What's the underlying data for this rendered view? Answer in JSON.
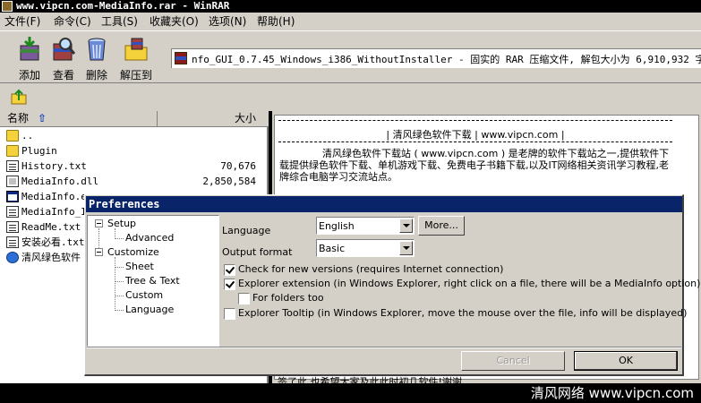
{
  "window": {
    "title": "www.vipcn.com-MediaInfo.rar - WinRAR"
  },
  "menu": [
    "文件(F)",
    "命令(C)",
    "工具(S)",
    "收藏夹(O)",
    "选项(N)",
    "帮助(H)"
  ],
  "toolbar": {
    "add": "添加",
    "view": "查看",
    "delete": "删除",
    "extract": "解压到"
  },
  "path": "nfo_GUI_0.7.45_Windows_i386_WithoutInstaller - 固实的 RAR 压缩文件, 解包大小为 6,910,932 字节",
  "filelist": {
    "col_name": "名称",
    "col_size": "大小",
    "rows": [
      {
        "name": "..",
        "size": "",
        "icon": "folder-icon"
      },
      {
        "name": "Plugin",
        "size": "",
        "icon": "folder-icon"
      },
      {
        "name": "History.txt",
        "size": "70,676",
        "icon": "text-file-icon"
      },
      {
        "name": "MediaInfo.dll",
        "size": "2,850,584",
        "icon": "dll-file-icon"
      },
      {
        "name": "MediaInfo.ex",
        "size": "",
        "icon": "exe-file-icon"
      },
      {
        "name": "MediaInfo_In",
        "size": "",
        "icon": "text-file-icon"
      },
      {
        "name": "ReadMe.txt",
        "size": "",
        "icon": "text-file-icon"
      },
      {
        "name": "安装必看.txt",
        "size": "",
        "icon": "text-file-icon"
      },
      {
        "name": "清风绿色软件",
        "size": "",
        "icon": "web-shortcut-icon"
      }
    ]
  },
  "comment": {
    "site": "|  清风绿色软件下载  |  www.vipcn.com  |",
    "para": "清风绿色软件下载站 ( www.vipcn.com ) 是老牌的软件下载站之一,提供软件下载提供绿色软件下载、单机游戏下载、免费电子书籍下载,以及IT网络相关资讯学习教程,老牌综合电脑学习交流站点。",
    "bottom": "签了此,也希望大家及此此时初几软件!谢谢"
  },
  "watermark": "清风网络 www.vipcn.com",
  "prefs": {
    "title": "Preferences",
    "tree": [
      {
        "label": "Setup",
        "level": 0
      },
      {
        "label": "Advanced",
        "level": 1
      },
      {
        "label": "Customize",
        "level": 0
      },
      {
        "label": "Sheet",
        "level": 1
      },
      {
        "label": "Tree & Text",
        "level": 1
      },
      {
        "label": "Custom",
        "level": 1
      },
      {
        "label": "Language",
        "level": 1
      }
    ],
    "language_label": "Language",
    "language_value": "English",
    "more_button": "More...",
    "output_label": "Output format",
    "output_value": "Basic",
    "check_versions": "Check for new versions (requires Internet connection)",
    "check_versions_on": true,
    "explorer_ext": "Explorer extension (in Windows Explorer, right click on a file, there will be a MediaInfo option)",
    "explorer_ext_on": true,
    "for_folders": "For folders too",
    "for_folders_on": false,
    "explorer_tooltip": "Explorer Tooltip (in Windows Explorer, move the mouse over the file, info will be displayed)",
    "explorer_tooltip_on": false,
    "cancel": "Cancel",
    "ok": "OK"
  }
}
